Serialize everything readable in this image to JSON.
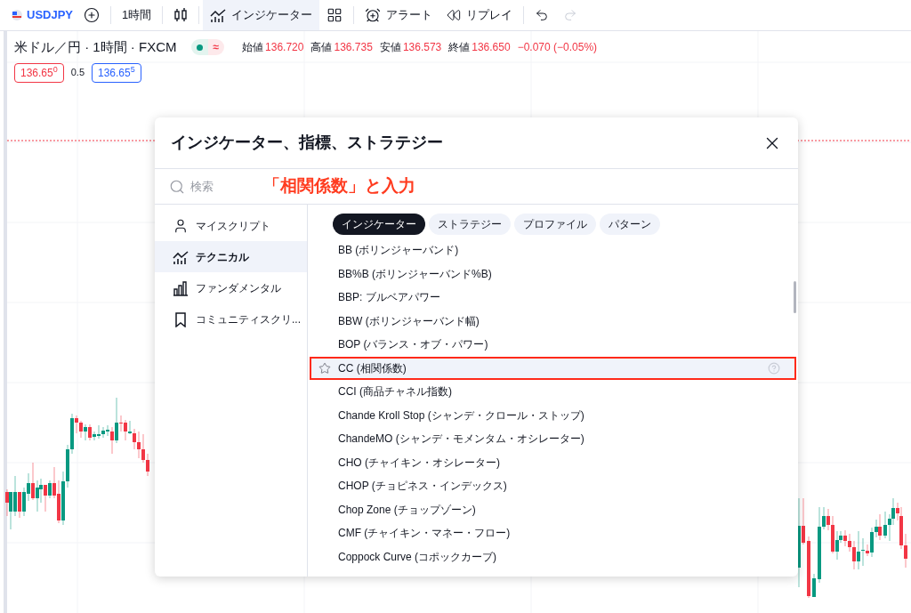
{
  "toolbar": {
    "symbol": "USDJPY",
    "interval": "1時間",
    "indicators": {
      "label": "インジケーター",
      "selected": true
    },
    "alert": "アラート",
    "replay": "リプレイ",
    "redo_disabled": true
  },
  "legend": {
    "title": "米ドル／円 · 1時間 · FXCM",
    "market_open": true,
    "approx": "≈",
    "values": [
      {
        "label": "始値",
        "value": "136.720"
      },
      {
        "label": "高値",
        "value": "136.735"
      },
      {
        "label": "安値",
        "value": "136.573"
      },
      {
        "label": "終値",
        "value": "136.650"
      }
    ],
    "change": "−0.070 (−0.05%)",
    "sell": "136.65$^{0}$",
    "spread": "0.5",
    "buy": "136.65$^{5}$"
  },
  "dialog": {
    "title": "インジケーター、指標、ストラテジー",
    "search": {
      "placeholder": "検索"
    },
    "annotation": "「相関係数」と入力",
    "sidebar": [
      {
        "kind": "user",
        "label": "マイスクリプト",
        "selected": false
      },
      {
        "kind": "technical",
        "label": "テクニカル",
        "selected": true
      },
      {
        "kind": "fundamental",
        "label": "ファンダメンタル",
        "selected": false
      },
      {
        "kind": "community",
        "label": "コミュニティスクリ...",
        "selected": false
      }
    ],
    "chips": [
      {
        "label": "インジケーター",
        "selected": true
      },
      {
        "label": "ストラテジー",
        "selected": false
      },
      {
        "label": "プロファイル",
        "selected": false
      },
      {
        "label": "パターン",
        "selected": false
      }
    ],
    "items": [
      {
        "label": "BB (ボリンジャーバンド)",
        "selected": false,
        "outlined": false
      },
      {
        "label": "BB%B (ボリンジャーバンド%B)",
        "selected": false,
        "outlined": false
      },
      {
        "label": "BBP: ブルベアパワー",
        "selected": false,
        "outlined": false
      },
      {
        "label": "BBW (ボリンジャーバンド幅)",
        "selected": false,
        "outlined": false
      },
      {
        "label": "BOP (バランス・オブ・パワー)",
        "selected": false,
        "outlined": false
      },
      {
        "label": "CC (相関係数)",
        "selected": true,
        "outlined": true
      },
      {
        "label": "CCI (商品チャネル指数)",
        "selected": false,
        "outlined": false
      },
      {
        "label": "Chande Kroll Stop (シャンデ・クロール・ストップ)",
        "selected": false,
        "outlined": false
      },
      {
        "label": "ChandeMO (シャンデ・モメンタム・オシレーター)",
        "selected": false,
        "outlined": false
      },
      {
        "label": "CHO (チャイキン・オシレーター)",
        "selected": false,
        "outlined": false
      },
      {
        "label": "CHOP (チョピネス・インデックス)",
        "selected": false,
        "outlined": false
      },
      {
        "label": "Chop Zone (チョップゾーン)",
        "selected": false,
        "outlined": false
      },
      {
        "label": "CMF (チャイキン・マネー・フロー)",
        "selected": false,
        "outlined": false
      },
      {
        "label": "Coppock Curve (コポックカーブ)",
        "selected": false,
        "outlined": false
      }
    ]
  }
}
